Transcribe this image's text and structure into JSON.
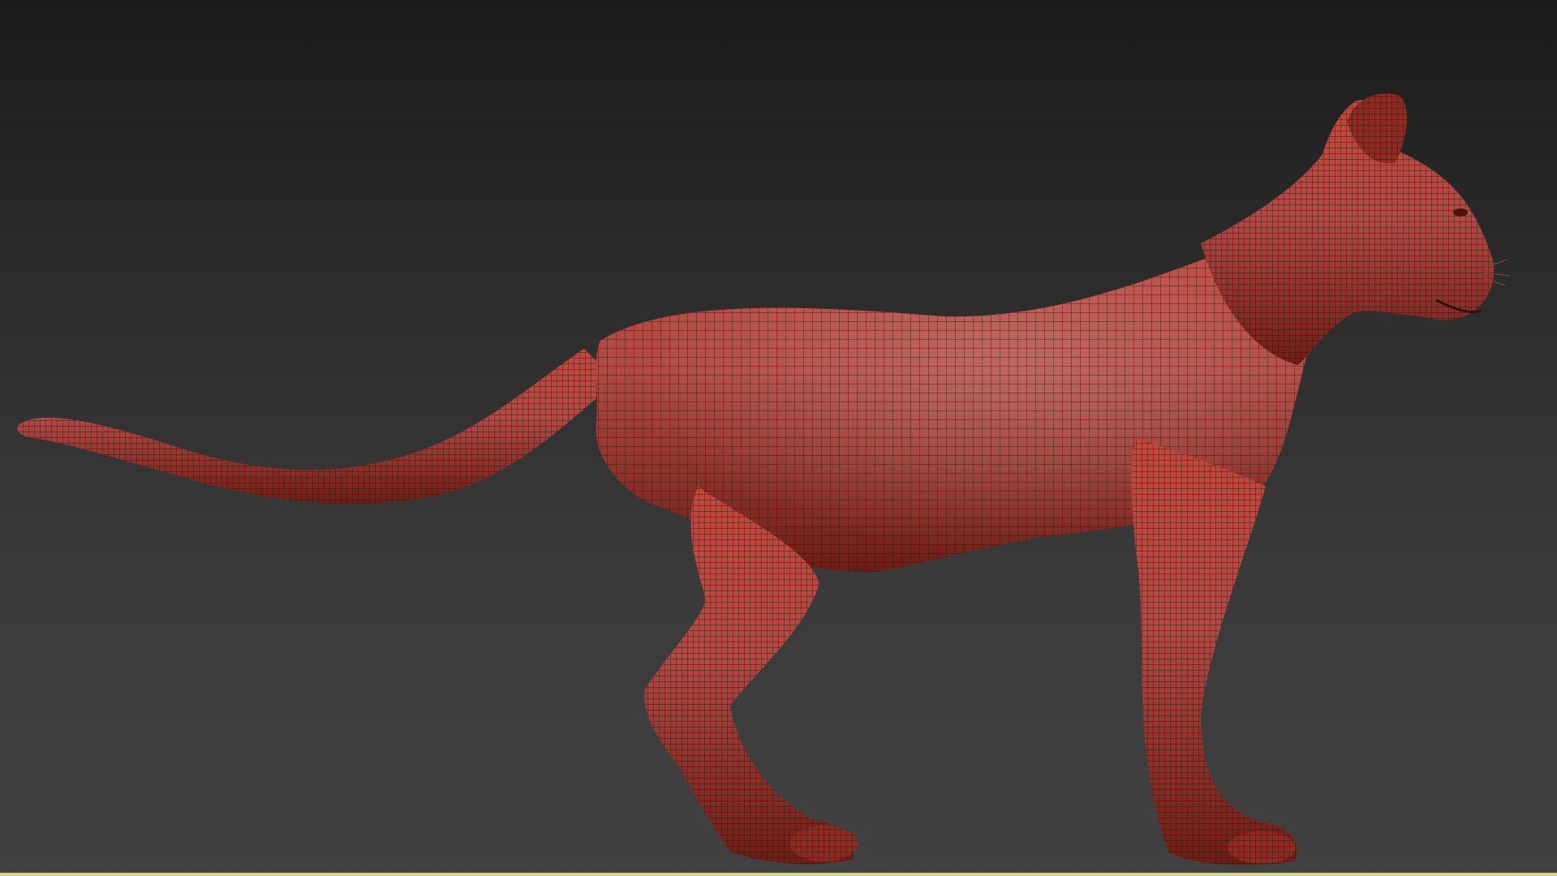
{
  "viewport": {
    "background_top": "#1c1c1c",
    "background_bottom": "#414141",
    "model": {
      "subject": "cat",
      "view": "side",
      "display_mode": "polyframe",
      "material_color": "#a8392e",
      "wire_color": "#2a0d0a"
    }
  },
  "status_bar": {
    "color": "#d9d29a"
  }
}
